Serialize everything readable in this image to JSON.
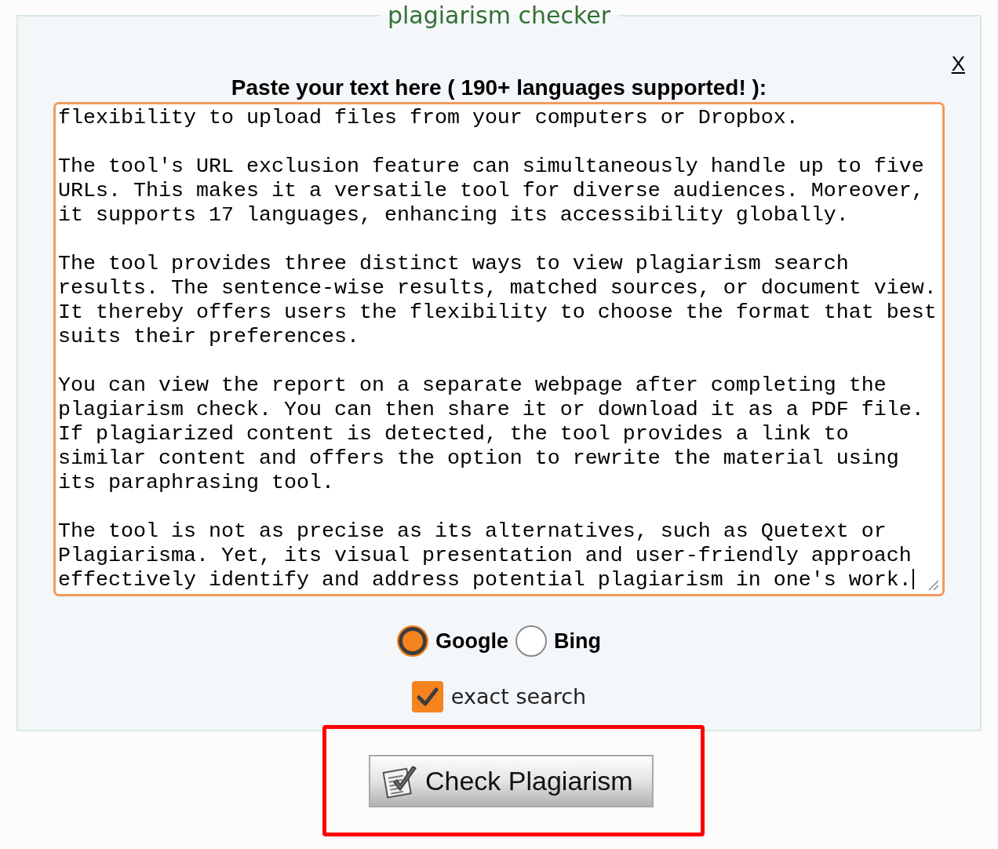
{
  "panel": {
    "title": "plagiarism checker",
    "close": "X"
  },
  "input": {
    "label": "Paste your text here ( 190+ languages supported! ):",
    "focused": true,
    "value": "flexibility to upload files from your computers or Dropbox.\n\nThe tool's URL exclusion feature can simultaneously handle up to five URLs. This makes it a versatile tool for diverse audiences. Moreover, it supports 17 languages, enhancing its accessibility globally.\n\nThe tool provides three distinct ways to view plagiarism search results. The sentence-wise results, matched sources, or document view. It thereby offers users the flexibility to choose the format that best suits their preferences.\n\nYou can view the report on a separate webpage after completing the plagiarism check. You can then share it or download it as a PDF file. If plagiarized content is detected, the tool provides a link to similar content and offers the option to rewrite the material using its paraphrasing tool.\n\nThe tool is not as precise as its alternatives, such as Quetext or Plagiarisma. Yet, its visual presentation and user-friendly approach effectively identify and address potential plagiarism in one's work."
  },
  "engines": [
    {
      "label": "Google",
      "selected": true
    },
    {
      "label": "Bing",
      "selected": false
    }
  ],
  "options": [
    {
      "label": "exact search",
      "checked": true
    }
  ],
  "submit_button": {
    "label": "Check Plagiarism",
    "highlighted": true
  }
}
